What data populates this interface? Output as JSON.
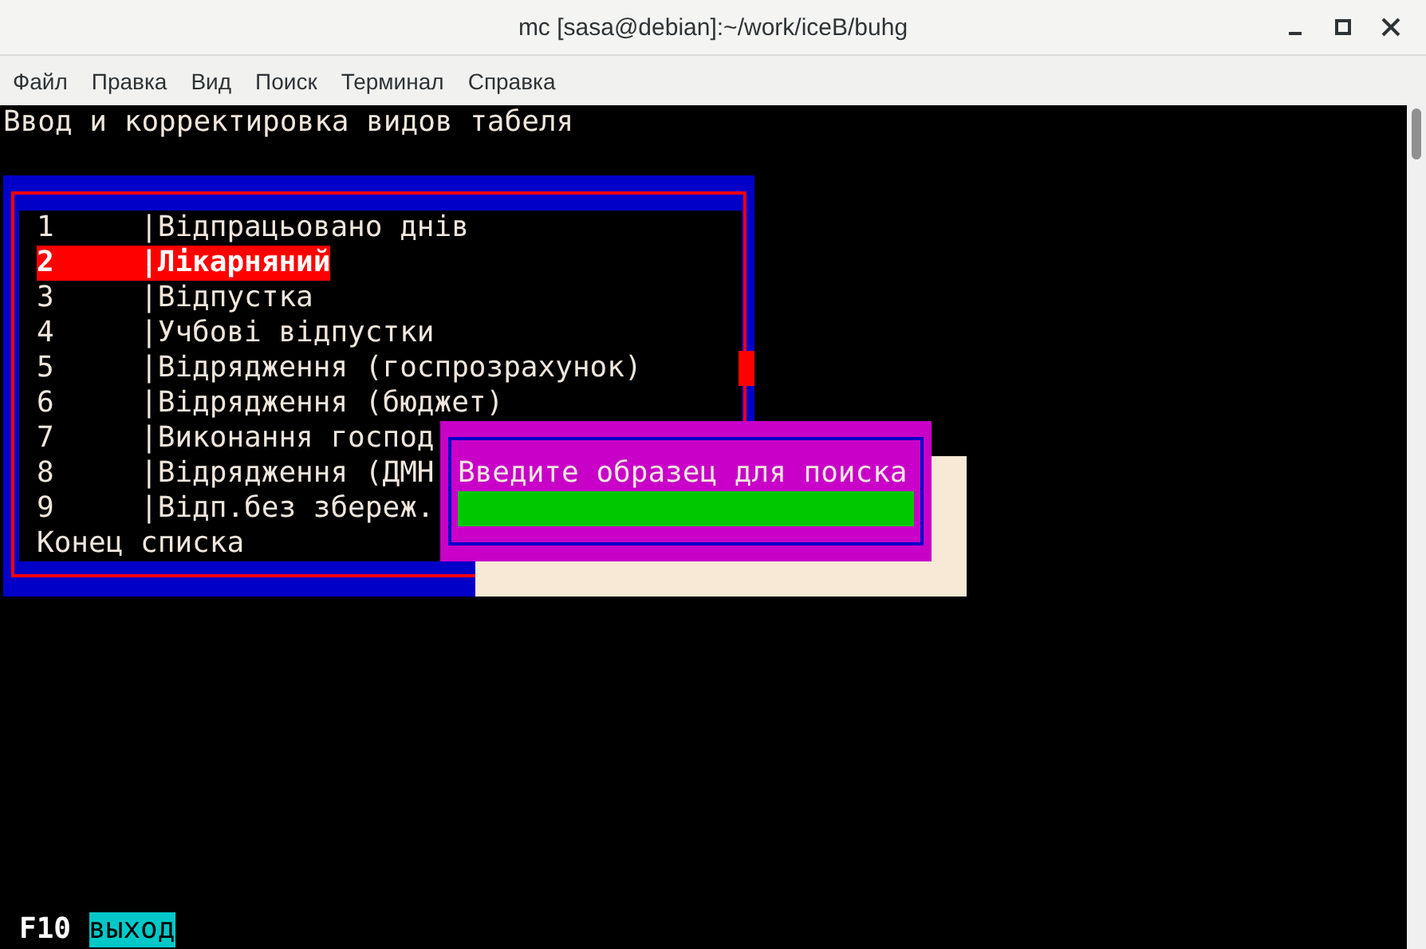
{
  "window": {
    "title": "mc [sasa@debian]:~/work/iceB/buhg"
  },
  "menu": [
    "Файл",
    "Правка",
    "Вид",
    "Поиск",
    "Терминал",
    "Справка"
  ],
  "terminal": {
    "heading": "Ввод и корректировка видов табеля",
    "list": {
      "items": [
        {
          "number": "1",
          "label": "|Відпрацьовано днів",
          "selected": false
        },
        {
          "number": "2",
          "label": "|Лікарняний",
          "selected": true
        },
        {
          "number": "3",
          "label": "|Відпустка",
          "selected": false
        },
        {
          "number": "4",
          "label": "|Учбові відпустки",
          "selected": false
        },
        {
          "number": "5",
          "label": "|Відрядження (госпрозрахунок)",
          "selected": false
        },
        {
          "number": "6",
          "label": "|Відрядження (бюджет)",
          "selected": false
        },
        {
          "number": "7",
          "label": "|Виконання господ",
          "selected": false
        },
        {
          "number": "8",
          "label": "|Відрядження (ДМН",
          "selected": false
        },
        {
          "number": "9",
          "label": "|Відп.без збереж.",
          "selected": false
        }
      ],
      "end_marker": "Конец списка"
    },
    "search_dialog": {
      "prompt": "Введите образец для поиска"
    },
    "footer": {
      "key": "F10",
      "action": "выход"
    }
  }
}
